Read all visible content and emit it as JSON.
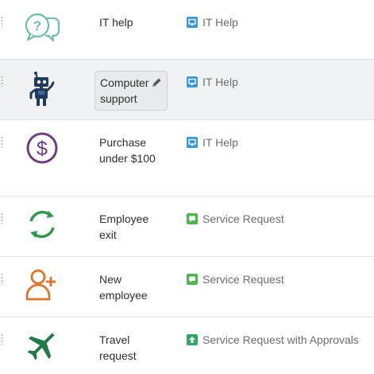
{
  "colors": {
    "teal": "#6dbfa8",
    "navy": "#1e3a5f",
    "purple": "#6b3f7f",
    "green": "#2e9a4e",
    "orange": "#e07428",
    "dark_green": "#1f7a45",
    "it_help_badge": "#3a9ad9",
    "service_request_badge": "#4cb64f",
    "approvals_badge": "#2fa864",
    "row_selected_bg": "#f1f2f4"
  },
  "rows": [
    {
      "icon": "chat-question-icon",
      "name": "IT help",
      "type_icon": "monitor-icon",
      "type": "IT Help"
    },
    {
      "icon": "robot-icon",
      "name": "Computer support",
      "type_icon": "monitor-icon",
      "type": "IT Help",
      "editing": true
    },
    {
      "icon": "dollar-circle-icon",
      "name": "Purchase under $100",
      "type_icon": "monitor-icon",
      "type": "IT Help"
    },
    {
      "icon": "sync-arrows-icon",
      "name": "Employee exit",
      "type_icon": "chat-bubble-icon",
      "type": "Service Request"
    },
    {
      "icon": "add-user-icon",
      "name": "New employee",
      "type_icon": "chat-bubble-icon",
      "type": "Service Request"
    },
    {
      "icon": "airplane-icon",
      "name": "Travel request",
      "type_icon": "arrow-up-icon",
      "type": "Service Request with Approvals"
    }
  ]
}
